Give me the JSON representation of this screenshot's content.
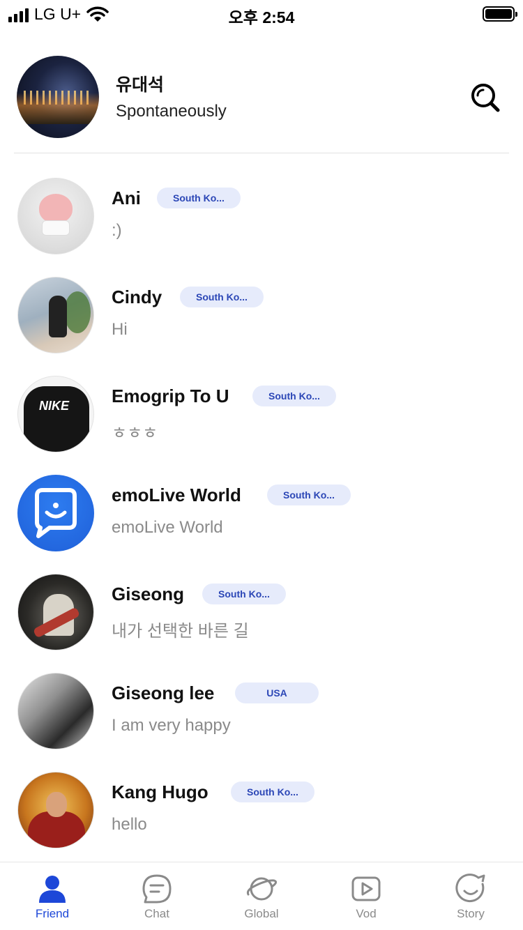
{
  "status_bar": {
    "carrier": "LG U+",
    "time": "오후 2:54"
  },
  "profile": {
    "name": "유대석",
    "status": "Spontaneously"
  },
  "friends": [
    {
      "name": "Ani",
      "country": "South Ko...",
      "message": ":)"
    },
    {
      "name": "Cindy",
      "country": "South Ko...",
      "message": "Hi"
    },
    {
      "name": "Emogrip To U",
      "country": "South Ko...",
      "message": "ㅎㅎㅎ"
    },
    {
      "name": "emoLive World",
      "country": "South Ko...",
      "message": "emoLive World"
    },
    {
      "name": "Giseong",
      "country": "South Ko...",
      "message": "내가 선택한 바른 길"
    },
    {
      "name": "Giseong lee",
      "country": "USA",
      "message": "I am very happy"
    },
    {
      "name": "Kang Hugo",
      "country": "South Ko...",
      "message": "hello"
    }
  ],
  "tabs": [
    {
      "label": "Friend",
      "icon": "person-icon",
      "active": true
    },
    {
      "label": "Chat",
      "icon": "chat-icon",
      "active": false
    },
    {
      "label": "Global",
      "icon": "planet-icon",
      "active": false
    },
    {
      "label": "Vod",
      "icon": "play-icon",
      "active": false
    },
    {
      "label": "Story",
      "icon": "smile-icon",
      "active": false
    }
  ],
  "colors": {
    "accent": "#1d47d8",
    "badge_bg": "#e6ebfb",
    "badge_text": "#2b46b6",
    "inactive": "#8a8a8a"
  }
}
